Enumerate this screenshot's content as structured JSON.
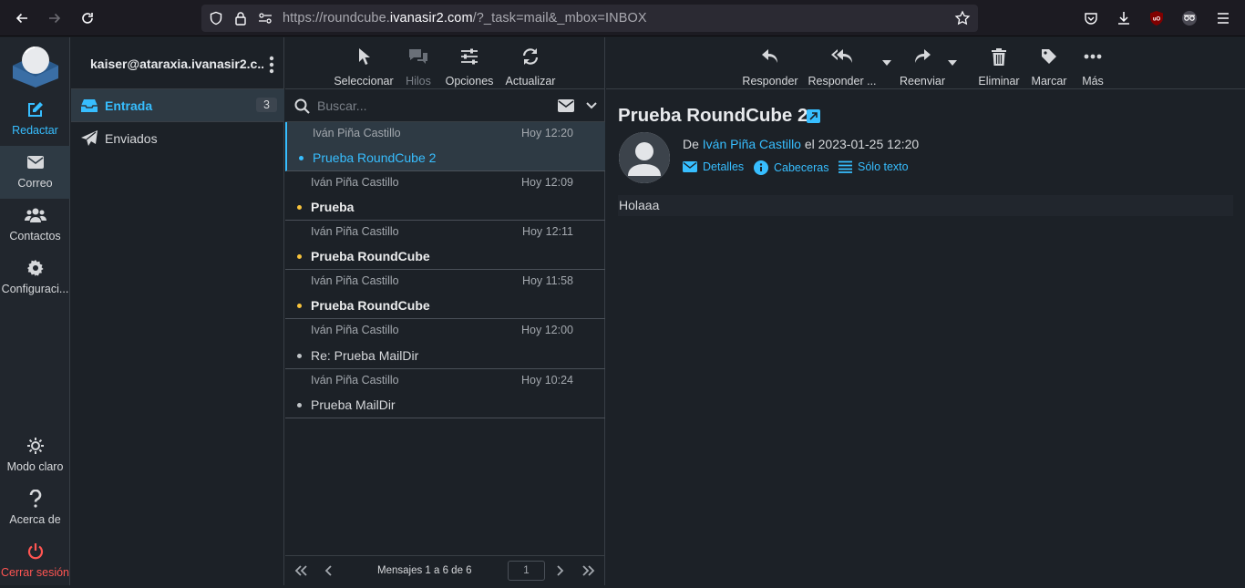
{
  "browser": {
    "url_prefix": "https://roundcube.",
    "url_domain": "ivanasir2.com",
    "url_suffix": "/?_task=mail&_mbox=INBOX"
  },
  "nav": {
    "compose": "Redactar",
    "mail": "Correo",
    "contacts": "Contactos",
    "settings": "Configuraci...",
    "light_mode": "Modo claro",
    "about": "Acerca de",
    "logout": "Cerrar sesión"
  },
  "account": "kaiser@ataraxia.ivanasir2.c...",
  "folders": [
    {
      "label": "Entrada",
      "count": "3"
    },
    {
      "label": "Enviados"
    }
  ],
  "list_toolbar": {
    "select": "Seleccionar",
    "threads": "Hilos",
    "options": "Opciones",
    "refresh": "Actualizar"
  },
  "search": {
    "placeholder": "Buscar..."
  },
  "messages": [
    {
      "from": "Iván Piña Castillo",
      "date": "Hoy 12:20",
      "subject": "Prueba RoundCube 2"
    },
    {
      "from": "Iván Piña Castillo",
      "date": "Hoy 12:09",
      "subject": "Prueba"
    },
    {
      "from": "Iván Piña Castillo",
      "date": "Hoy 12:11",
      "subject": "Prueba RoundCube"
    },
    {
      "from": "Iván Piña Castillo",
      "date": "Hoy 11:58",
      "subject": "Prueba RoundCube"
    },
    {
      "from": "Iván Piña Castillo",
      "date": "Hoy 12:00",
      "subject": "Re: Prueba MailDir"
    },
    {
      "from": "Iván Piña Castillo",
      "date": "Hoy 10:24",
      "subject": "Prueba MailDir"
    }
  ],
  "pager": {
    "text": "Mensajes 1 a 6 de 6",
    "page": "1"
  },
  "reader_toolbar": {
    "reply": "Responder",
    "reply_all": "Responder ...",
    "forward": "Reenviar",
    "delete": "Eliminar",
    "mark": "Marcar",
    "more": "Más"
  },
  "message": {
    "subject": "Prueba RoundCube 2",
    "from_prefix": "De",
    "from_name": "Iván Piña Castillo",
    "date_text": "el 2023-01-25 12:20",
    "details": "Detalles",
    "headers": "Cabeceras",
    "plain_text": "Sólo texto",
    "body": "Holaaa"
  },
  "colors": {
    "accent": "#37beff",
    "unread_dot": "#f8c33c",
    "logout": "#ff5552"
  }
}
